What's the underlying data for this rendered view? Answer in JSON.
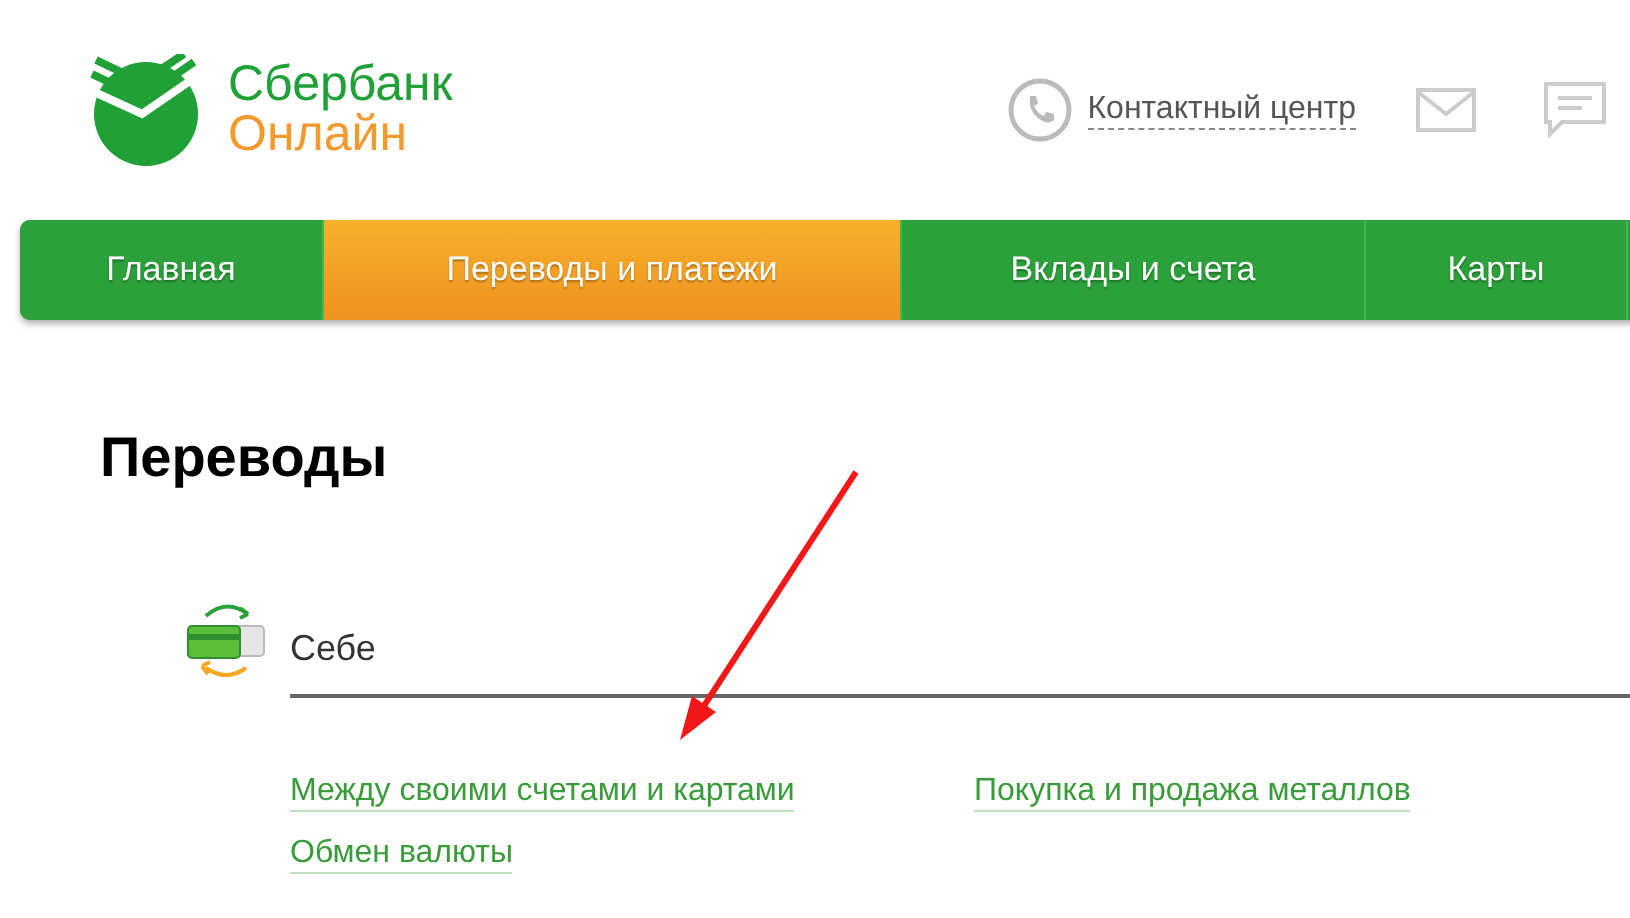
{
  "header": {
    "logo": {
      "line_1": "Сбербанк",
      "line_2": "Онлайн"
    },
    "contact_center": "Контактный центр"
  },
  "nav": [
    {
      "label": "Главная",
      "selected": false
    },
    {
      "label": "Переводы и платежи",
      "selected": true
    },
    {
      "label": "Вклады и счета",
      "selected": false
    },
    {
      "label": "Карты",
      "selected": false
    }
  ],
  "page_title": "Переводы",
  "section": {
    "title": "Себе",
    "links": [
      "Между своими счетами и картами",
      "Покупка и продажа металлов",
      "Обмен валюты"
    ]
  }
}
